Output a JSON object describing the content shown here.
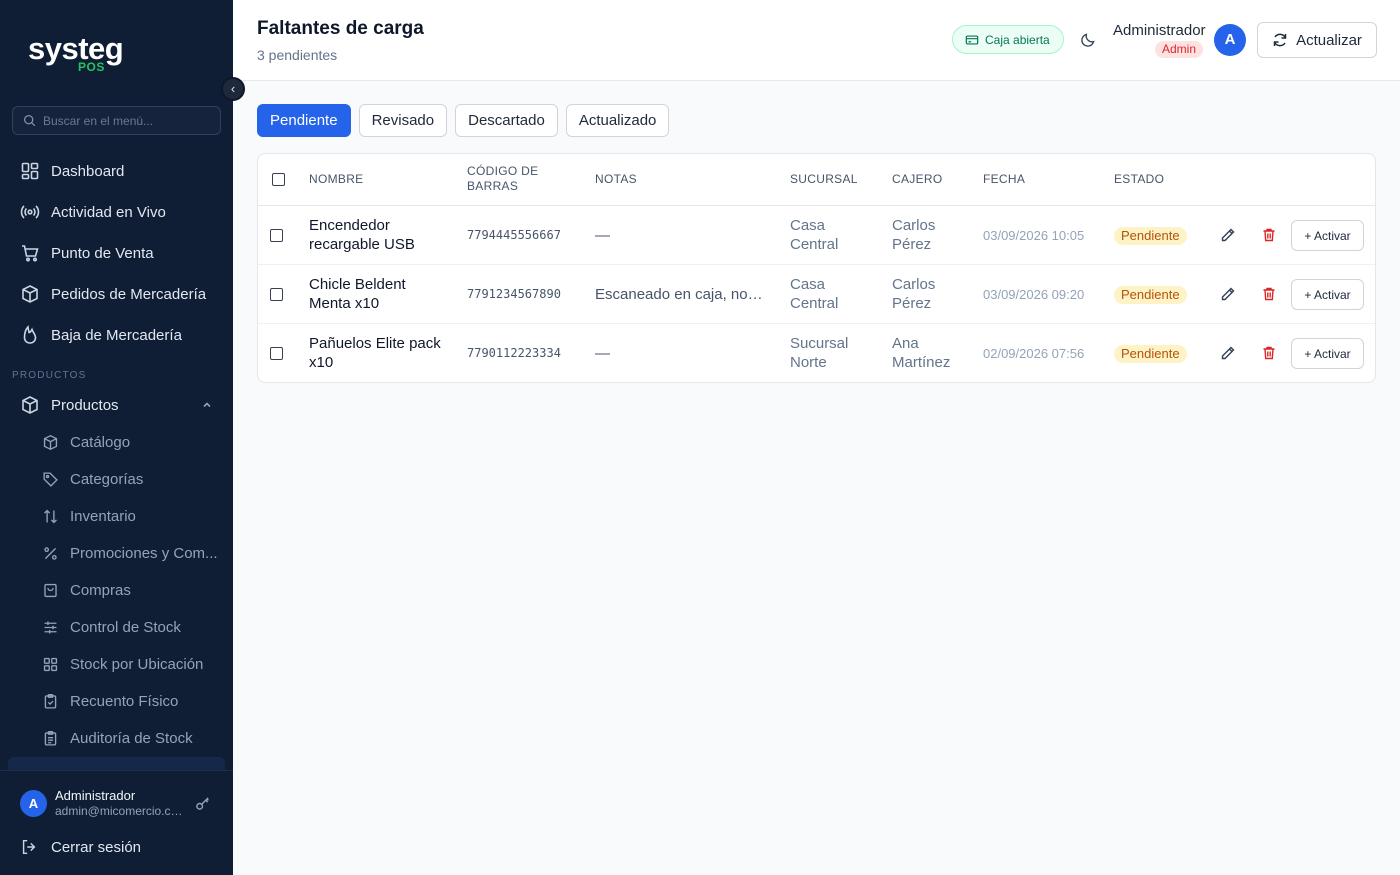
{
  "brand": {
    "name": "systeg",
    "sub": "POS"
  },
  "sidebar": {
    "search_placeholder": "Buscar en el menú...",
    "main_items": [
      {
        "label": "Dashboard",
        "icon": "dashboard-icon"
      },
      {
        "label": "Actividad en Vivo",
        "icon": "broadcast-icon"
      },
      {
        "label": "Punto de Venta",
        "icon": "cart-icon"
      },
      {
        "label": "Pedidos de Mercadería",
        "icon": "package-icon"
      },
      {
        "label": "Baja de Mercadería",
        "icon": "flame-icon"
      }
    ],
    "section_label": "PRODUCTOS",
    "group": {
      "label": "Productos",
      "icon": "box-icon"
    },
    "sub_items": [
      {
        "label": "Catálogo",
        "icon": "box-icon"
      },
      {
        "label": "Categorías",
        "icon": "tag-icon"
      },
      {
        "label": "Inventario",
        "icon": "arrows-icon"
      },
      {
        "label": "Promociones y Com...",
        "icon": "percent-icon"
      },
      {
        "label": "Compras",
        "icon": "bag-icon"
      },
      {
        "label": "Control de Stock",
        "icon": "sliders-icon"
      },
      {
        "label": "Stock por Ubicación",
        "icon": "grid-icon"
      },
      {
        "label": "Recuento Físico",
        "icon": "clipboard-icon"
      },
      {
        "label": "Auditoría de Stock",
        "icon": "clipboard-list-icon"
      }
    ],
    "user": {
      "initial": "A",
      "name": "Administrador",
      "email": "admin@micomercio.com"
    },
    "logout_label": "Cerrar sesión"
  },
  "header": {
    "title": "Faltantes de carga",
    "subtitle": "3 pendientes",
    "caja_label": "Caja abierta",
    "admin_name": "Administrador",
    "admin_role": "Admin",
    "avatar_initial": "A",
    "refresh_label": "Actualizar"
  },
  "tabs": [
    {
      "label": "Pendiente",
      "active": true
    },
    {
      "label": "Revisado",
      "active": false
    },
    {
      "label": "Descartado",
      "active": false
    },
    {
      "label": "Actualizado",
      "active": false
    }
  ],
  "table": {
    "headers": {
      "name": "NOMBRE",
      "barcode": "CÓDIGO DE BARRAS",
      "notes": "NOTAS",
      "branch": "SUCURSAL",
      "cashier": "CAJERO",
      "date": "FECHA",
      "status": "ESTADO"
    },
    "action_label": "+ Activar",
    "rows": [
      {
        "name": "Encendedor recargable USB",
        "barcode": "7794445556667",
        "notes": "—",
        "branch": "Casa Central",
        "cashier": "Carlos Pérez",
        "date": "03/09/2026 10:05",
        "status": "Pendiente"
      },
      {
        "name": "Chicle Beldent Menta x10",
        "barcode": "7791234567890",
        "notes": "Escaneado en caja, no fi...",
        "branch": "Casa Central",
        "cashier": "Carlos Pérez",
        "date": "03/09/2026 09:20",
        "status": "Pendiente"
      },
      {
        "name": "Pañuelos Elite pack x10",
        "barcode": "7790112223334",
        "notes": "—",
        "branch": "Sucursal Norte",
        "cashier": "Ana Martínez",
        "date": "02/09/2026 07:56",
        "status": "Pendiente"
      }
    ]
  },
  "colors": {
    "accent": "#2563eb",
    "sidebar_bg": "#0f1d35",
    "success": "#047857",
    "danger": "#dc2626",
    "warning": "#b45309"
  }
}
